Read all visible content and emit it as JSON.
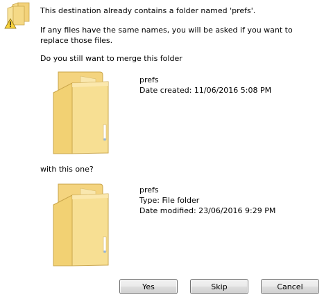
{
  "message": {
    "heading": "This destination already contains a folder named 'prefs'.",
    "detail": "If any files have the same names, you will be asked if you want to replace those files.",
    "question": "Do you still want to merge this folder",
    "with_this": "with this one?"
  },
  "source_folder": {
    "name": "prefs",
    "date_created": "Date created: 11/06/2016 5:08 PM"
  },
  "destination_folder": {
    "name": "prefs",
    "type": "Type: File folder",
    "date_modified": "Date modified: 23/06/2016 9:29 PM"
  },
  "buttons": {
    "yes": "Yes",
    "skip": "Skip",
    "cancel": "Cancel"
  },
  "icons": {
    "dialog": "warning-folder-icon",
    "folder": "folder-icon"
  },
  "colors": {
    "folder_fill": "#f6dc8a",
    "folder_edge": "#c9a54a",
    "warning_fill": "#f7d23c"
  }
}
